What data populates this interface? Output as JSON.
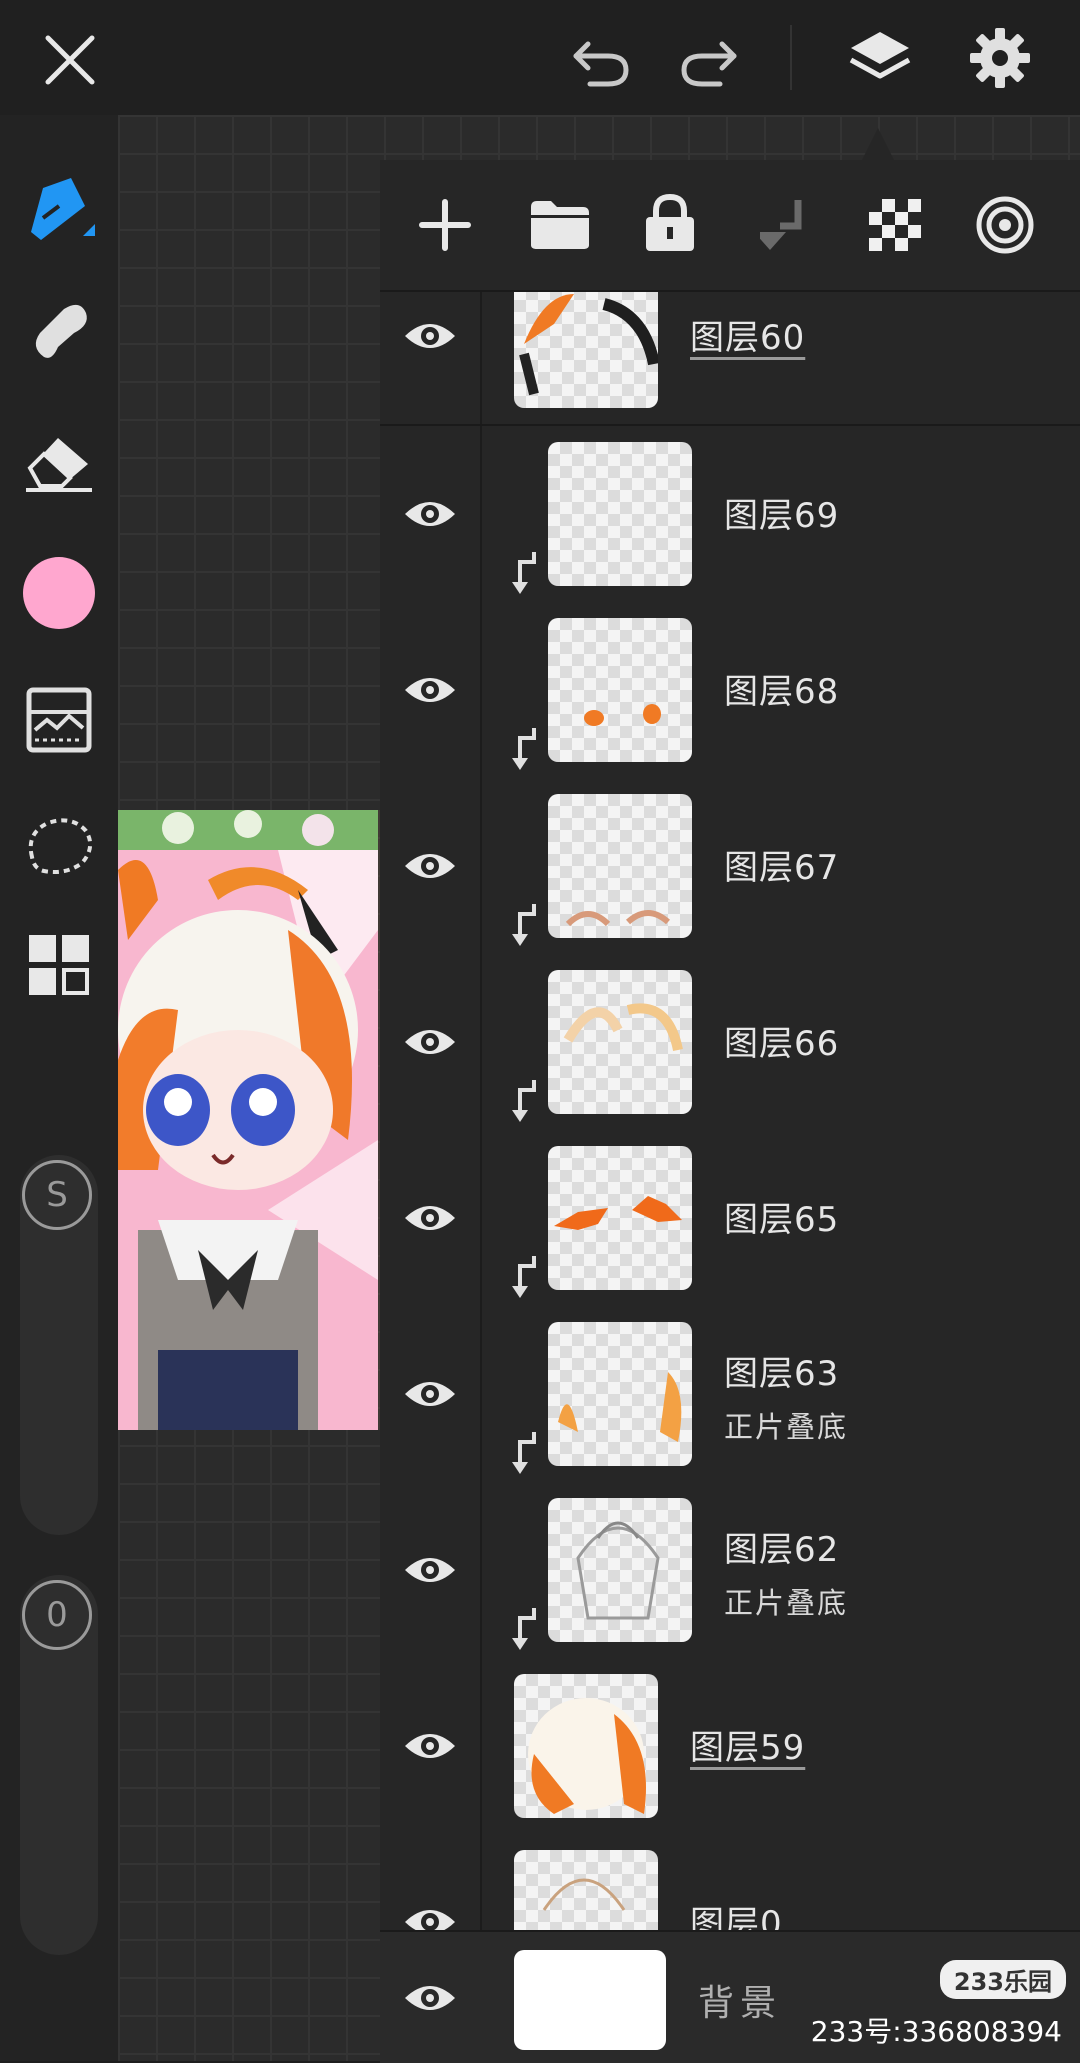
{
  "toolbar": {
    "close_icon": "close-icon",
    "undo_icon": "undo-icon",
    "redo_icon": "redo-icon",
    "layers_icon": "layers-icon",
    "settings_icon": "gear-icon"
  },
  "sidebar": {
    "tools": [
      "pen-tool",
      "smudge-tool",
      "eraser-tool",
      "color",
      "filter-tool",
      "lasso-tool",
      "layout-tool"
    ],
    "brush_color": "#ffa7cf",
    "accent": "#2196f3",
    "size_label": "S",
    "opacity_label": "0"
  },
  "panel": {
    "actions": [
      "add-layer",
      "folder",
      "lock",
      "clip-merge-down",
      "transparency",
      "reference"
    ],
    "layers": [
      {
        "name": "图层60",
        "blend": "",
        "clipped": false,
        "underline": true
      },
      {
        "name": "图层69",
        "blend": "",
        "clipped": true,
        "underline": false
      },
      {
        "name": "图层68",
        "blend": "",
        "clipped": true,
        "underline": false
      },
      {
        "name": "图层67",
        "blend": "",
        "clipped": true,
        "underline": false
      },
      {
        "name": "图层66",
        "blend": "",
        "clipped": true,
        "underline": false
      },
      {
        "name": "图层65",
        "blend": "",
        "clipped": true,
        "underline": false
      },
      {
        "name": "图层63",
        "blend": "正片叠底",
        "clipped": true,
        "underline": false
      },
      {
        "name": "图层62",
        "blend": "正片叠底",
        "clipped": true,
        "underline": false
      },
      {
        "name": "图层59",
        "blend": "",
        "clipped": false,
        "underline": true
      }
    ],
    "partial_layer_name": "图层0",
    "background_label": "背景"
  },
  "watermark": {
    "badge": "233乐园",
    "text": "233号:336808394"
  }
}
